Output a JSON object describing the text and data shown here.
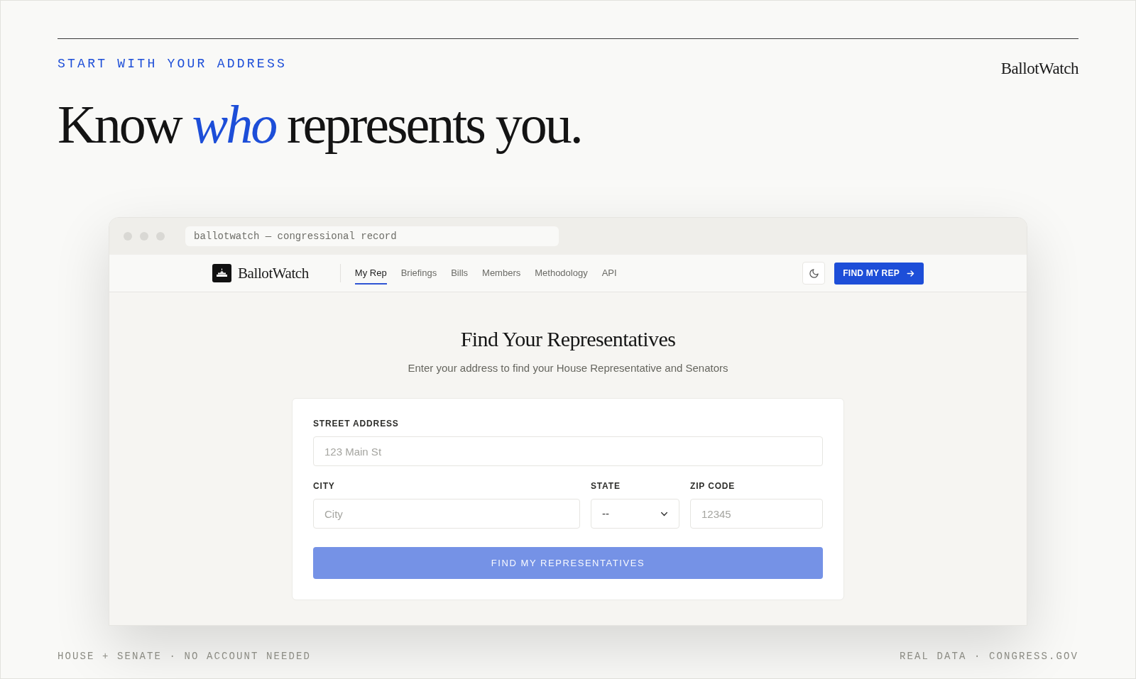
{
  "page": {
    "eyebrow": "START WITH YOUR ADDRESS",
    "brand": "BallotWatch",
    "headline": "Know *who* represents you."
  },
  "browser": {
    "address": "ballotwatch — congressional record"
  },
  "nav": {
    "brand": "BallotWatch",
    "items": [
      {
        "label": "My Rep",
        "selected": true
      },
      {
        "label": "Briefings",
        "selected": false
      },
      {
        "label": "Bills",
        "selected": false
      },
      {
        "label": "Members",
        "selected": false
      },
      {
        "label": "Methodology",
        "selected": false
      },
      {
        "label": "API",
        "selected": false
      }
    ],
    "cta": "FIND MY REP"
  },
  "main": {
    "title": "Find Your Representatives",
    "subtitle": "Enter your address to find your House Representative and Senators",
    "form": {
      "rows": [
        [
          {
            "kind": "text",
            "label": "STREET ADDRESS",
            "placeholder": "123 Main St"
          }
        ],
        [
          {
            "kind": "text",
            "label": "CITY",
            "placeholder": "City"
          },
          {
            "kind": "select",
            "label": "STATE",
            "value": "--"
          },
          {
            "kind": "text",
            "label": "ZIP CODE",
            "placeholder": "12345"
          }
        ]
      ],
      "submit": {
        "label": "FIND MY REPRESENTATIVES",
        "disabled": true
      }
    }
  },
  "footer": {
    "left": "HOUSE + SENATE · NO ACCOUNT NEEDED",
    "right": "REAL DATA · CONGRESS.GOV"
  }
}
